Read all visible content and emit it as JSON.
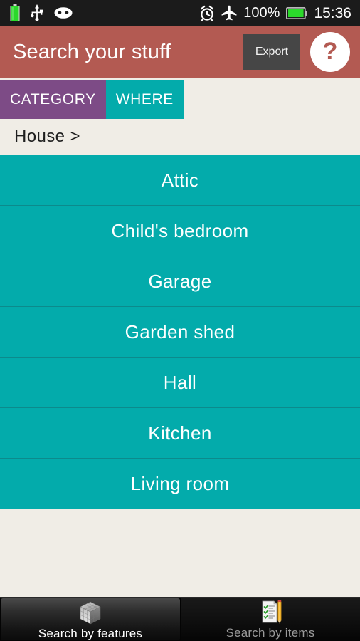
{
  "status_bar": {
    "left_icons": [
      "battery-charging-icon",
      "usb-icon",
      "cyanogenmod-icon"
    ],
    "right_icons": [
      "alarm-clock-icon",
      "airplane-mode-icon",
      "battery-icon"
    ],
    "battery_percent": "100%",
    "clock": "15:36"
  },
  "header": {
    "title": "Search your stuff",
    "export_label": "Export",
    "help_label": "?",
    "background_color": "#B35A52",
    "export_button_color": "#464646"
  },
  "tabs": [
    {
      "label": "CATEGORY",
      "active": false,
      "color": "#7D4B86"
    },
    {
      "label": "WHERE",
      "active": true,
      "color": "#03ABAB"
    }
  ],
  "breadcrumb": {
    "text": "House >"
  },
  "list": {
    "accent_color": "#03ABAB",
    "items": [
      {
        "label": "Attic"
      },
      {
        "label": "Child's bedroom"
      },
      {
        "label": "Garage"
      },
      {
        "label": "Garden shed"
      },
      {
        "label": "Hall"
      },
      {
        "label": "Kitchen"
      },
      {
        "label": "Living room"
      }
    ]
  },
  "bottom_tabs": [
    {
      "label": "Search by features",
      "icon": "cube-icon",
      "active": true
    },
    {
      "label": "Search by items",
      "icon": "checklist-pencil-icon",
      "active": false
    }
  ],
  "colors": {
    "background": "#F0EDE6",
    "teal": "#03ABAB",
    "purple": "#7D4B86",
    "red": "#B35A52"
  }
}
